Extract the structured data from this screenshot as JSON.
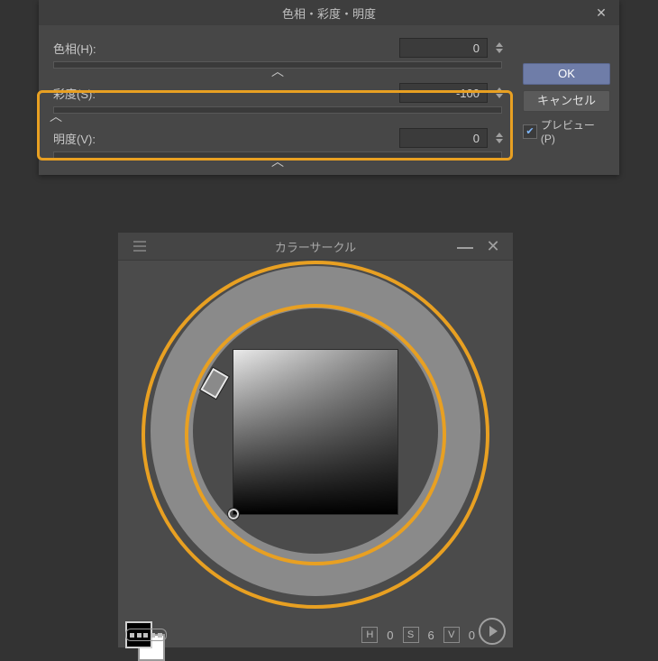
{
  "hsl_dialog": {
    "title": "色相・彩度・明度",
    "rows": {
      "hue": {
        "label": "色相(H):",
        "value": "0"
      },
      "sat": {
        "label": "彩度(S):",
        "value": "-100"
      },
      "val": {
        "label": "明度(V):",
        "value": "0"
      }
    },
    "ok_label": "OK",
    "cancel_label": "キャンセル",
    "preview_label": "プレビュー(P)",
    "preview_checked": true
  },
  "color_circle": {
    "title": "カラーサークル",
    "readout": {
      "h_letter": "H",
      "h_value": "0",
      "s_letter": "S",
      "s_value": "6",
      "v_letter": "V",
      "v_value": "0"
    }
  }
}
